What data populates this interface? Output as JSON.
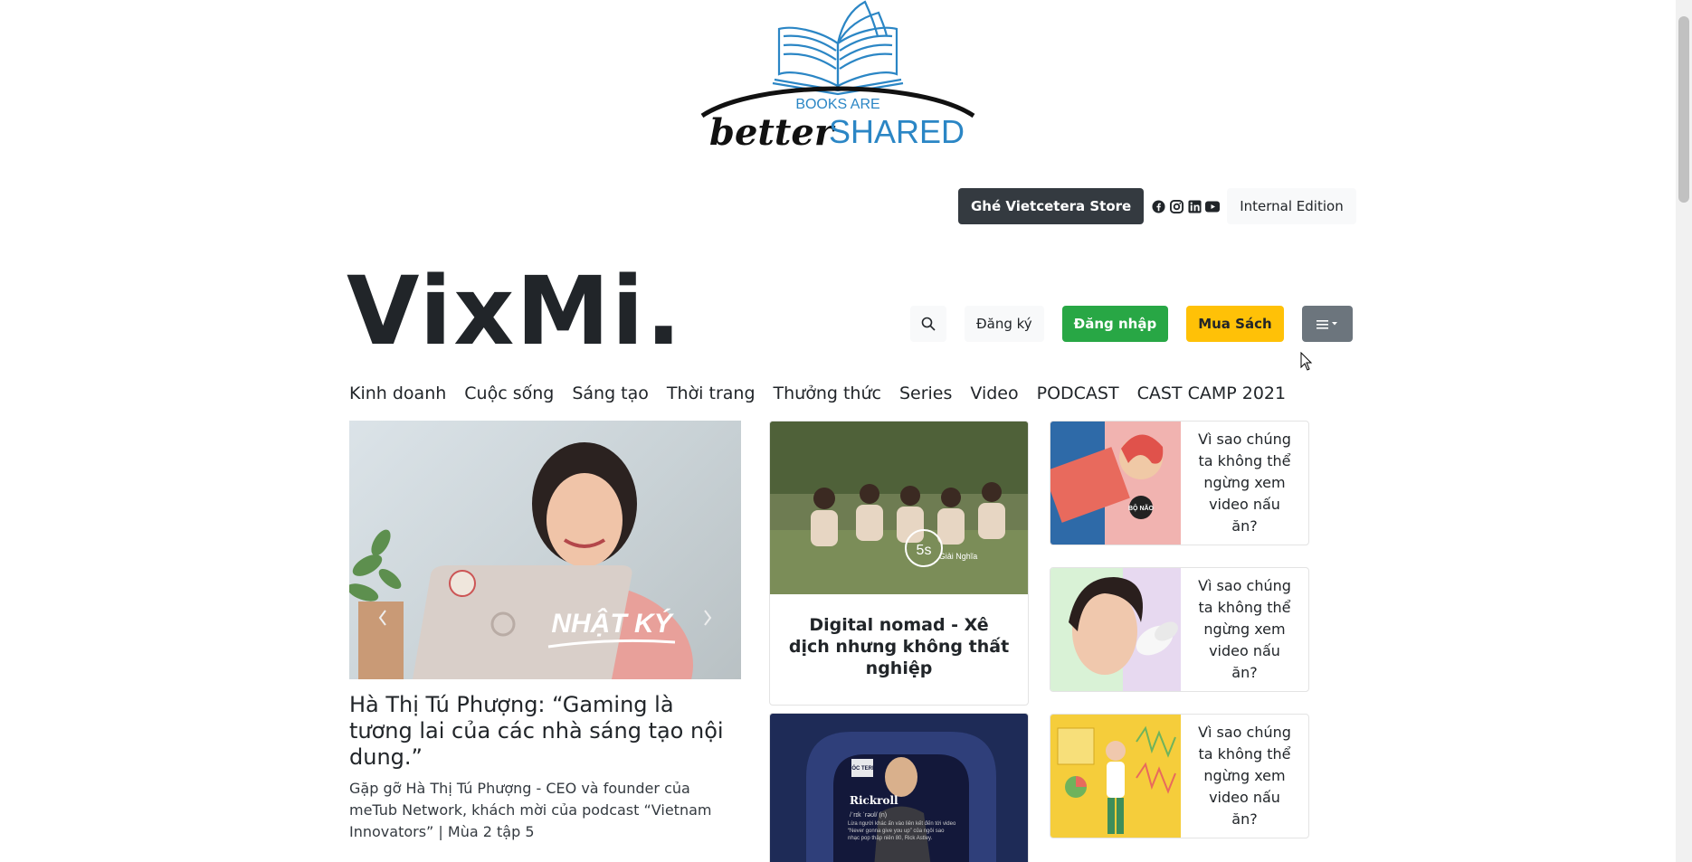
{
  "banner": {
    "line1": "BOOKS ARE",
    "word_better": "better",
    "word_shared": "SHARED"
  },
  "topbar": {
    "store_label": "Ghé Vietcetera Store",
    "edition_label": "Internal Edition",
    "social_icons": [
      "facebook-icon",
      "instagram-icon",
      "linkedin-icon",
      "youtube-icon"
    ]
  },
  "brand": {
    "name": "VixMi."
  },
  "actions": {
    "search_icon": "search-icon",
    "signup_label": "Đăng ký",
    "login_label": "Đăng nhập",
    "buy_label": "Mua Sách",
    "menu_icon": "menu-icon"
  },
  "nav": {
    "items": [
      "Kinh doanh",
      "Cuộc sống",
      "Sáng tạo",
      "Thời trang",
      "Thưởng thức",
      "Series",
      "Video",
      "PODCAST",
      "CAST CAMP 2021"
    ]
  },
  "feature": {
    "image_caption": "NHẬT KÝ",
    "title": "Hà Thị Tú Phượng: “Gaming là tương lai của các nhà sáng tạo nội dung.”",
    "description": "Gặp gỡ Hà Thị Tú Phượng - CEO và founder của meTub Network, khách mời của podcast “Vietnam Innovators” | Mùa 2 tập 5"
  },
  "mid_cards": [
    {
      "badge_main": "5s",
      "badge_sub": "Giải Nghĩa",
      "title": "Digital nomad - Xê dịch nhưng không thất nghiệp"
    },
    {
      "badge": "BÓC TERM",
      "heading": "Rickroll",
      "phonetic": "/ˈrɪk ˈrəʊl/ (n)",
      "caption": "Lừa người khác ấn vào liên kết đến tới video “Never gonna give you up” của ngôi sao nhạc pop thập niên 80, Rick Astley."
    }
  ],
  "side_cards": [
    {
      "title": "Vì sao chúng ta không thể ngừng xem video nấu ăn?",
      "badge": "BỘ NÃO"
    },
    {
      "title": "Vì sao chúng ta không thể ngừng xem video nấu ăn?"
    },
    {
      "title": "Vì sao chúng ta không thể ngừng xem video nấu ăn?"
    }
  ],
  "colors": {
    "dark": "#343a40",
    "green": "#28a745",
    "yellow": "#ffc107",
    "gray": "#6c757d",
    "light": "#f8f9fa",
    "logo_blue": "#2b86c5"
  }
}
